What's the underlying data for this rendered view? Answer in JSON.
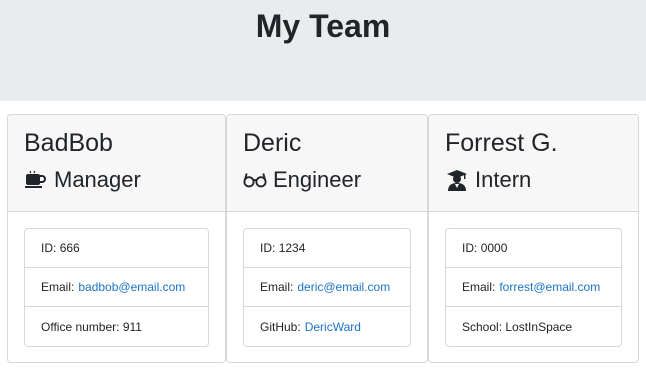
{
  "header": {
    "title": "My Team"
  },
  "cards": [
    {
      "name": "BadBob",
      "role": "Manager",
      "role_icon": "coffee-mug-icon",
      "id_label": "ID:",
      "id": "666",
      "email_label": "Email:",
      "email": "badbob@email.com",
      "extra_label": "Office number:",
      "extra": "911"
    },
    {
      "name": "Deric",
      "role": "Engineer",
      "role_icon": "glasses-icon",
      "id_label": "ID:",
      "id": "1234",
      "email_label": "Email:",
      "email": "deric@email.com",
      "extra_label": "GitHub:",
      "extra": "DericWard"
    },
    {
      "name": "Forrest G.",
      "role": "Intern",
      "role_icon": "graduate-icon",
      "id_label": "ID:",
      "id": "0000",
      "email_label": "Email:",
      "email": "forrest@email.com",
      "extra_label": "School:",
      "extra": "LostInSpace"
    }
  ],
  "colors": {
    "header_bg": "#e9ecef",
    "card_header_bg": "#f7f7f7",
    "link": "#1a73c9",
    "border": "#d5d8dc"
  }
}
